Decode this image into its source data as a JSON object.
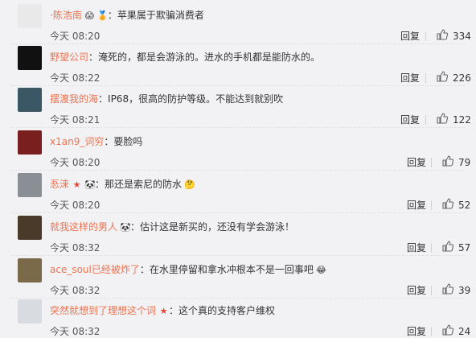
{
  "comments": [
    {
      "user": "·陈浩南",
      "badges": [
        "😱",
        "🏅"
      ],
      "text": "苹果属于欺骗消费者",
      "time": "今天 08:20",
      "reply": "回复",
      "likes": "334",
      "avatar_color": "#e9e9ea"
    },
    {
      "user": "野望公司",
      "badges": [],
      "text": "淹死的，都是会游泳的。进水的手机都是能防水的。",
      "time": "今天 08:22",
      "reply": "回复",
      "likes": "226",
      "avatar_color": "#111111"
    },
    {
      "user": "摆渡我的海",
      "badges": [],
      "text": "IP68，很高的防护等级。不能达到就别吹",
      "time": "今天 08:21",
      "reply": "回复",
      "likes": "122",
      "avatar_color": "#3b5665"
    },
    {
      "user": "x1an9_词穷",
      "badges": [],
      "text": "要脸吗",
      "time": "今天 08:20",
      "reply": "回复",
      "likes": "79",
      "avatar_color": "#7a1f1f"
    },
    {
      "user": "忢涞",
      "badges": [
        "★",
        "🐼"
      ],
      "text": "那还是索尼的防水",
      "emoji": "🤔",
      "time": "今天 08:20",
      "reply": "回复",
      "likes": "52",
      "avatar_color": "#8a8f95"
    },
    {
      "user": "就我这样的男人",
      "badges": [
        "🐼"
      ],
      "text": "估计这是新买的，还没有学会游泳！",
      "time": "今天 08:32",
      "reply": "回复",
      "likes": "57",
      "avatar_color": "#4a3a2a"
    },
    {
      "user": "ace_soul已经被炸了",
      "badges": [],
      "text": "在水里停留和拿水冲根本不是一回事吧",
      "emoji": "😂",
      "time": "今天 08:32",
      "reply": "回复",
      "likes": "39",
      "avatar_color": "#7a6a4a"
    },
    {
      "user": "突然就想到了理想这个词",
      "badges": [
        "★"
      ],
      "text": "这个真的支持客户维权",
      "time": "今天 08:32",
      "reply": "回复",
      "likes": "24",
      "avatar_color": "#d8dce0"
    }
  ]
}
